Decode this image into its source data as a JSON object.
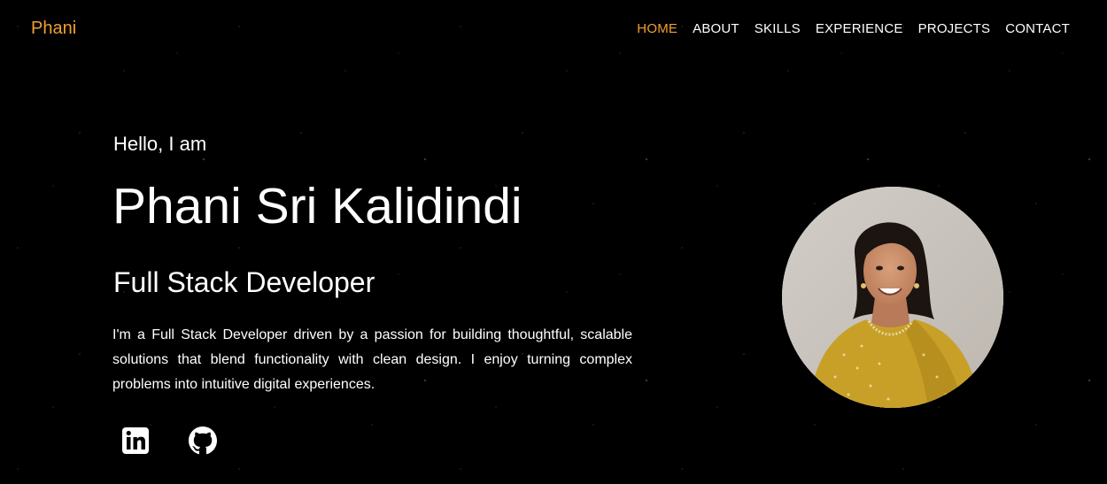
{
  "header": {
    "logo": "Phani",
    "nav": [
      {
        "label": "HOME",
        "active": true
      },
      {
        "label": "ABOUT"
      },
      {
        "label": "SKILLS"
      },
      {
        "label": "EXPERIENCE"
      },
      {
        "label": "PROJECTS"
      },
      {
        "label": "CONTACT"
      }
    ]
  },
  "hero": {
    "greeting": "Hello, I am",
    "name": "Phani Sri Kalidindi",
    "role": "Full Stack Developer",
    "bio": "I'm a Full Stack Developer driven by a passion for building thoughtful, scalable solutions that blend functionality with clean design. I enjoy turning complex problems into intuitive digital experiences."
  },
  "socials": [
    {
      "icon": "linkedin-icon"
    },
    {
      "icon": "github-icon"
    }
  ],
  "colors": {
    "background": "#000000",
    "accent": "#f0a030",
    "text": "#ffffff"
  }
}
